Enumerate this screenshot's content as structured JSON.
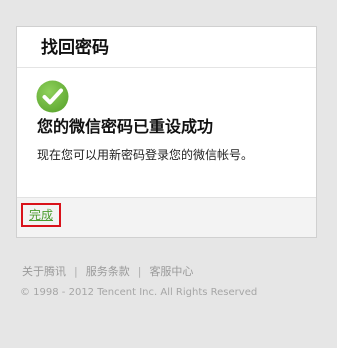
{
  "card": {
    "title": "找回密码",
    "success_title": "您的微信密码已重设成功",
    "success_desc": "现在您可以用新密码登录您的微信帐号。",
    "done_label": "完成"
  },
  "footer": {
    "links": [
      "关于腾讯",
      "服务条款",
      "客服中心"
    ],
    "separator": "|",
    "copyright": "© 1998 - 2012 Tencent Inc. All Rights Reserved"
  },
  "colors": {
    "page_bg": "#e6e6e6",
    "card_bg": "#ffffff",
    "check_green": "#6cb33f",
    "link_green": "#4b9c2e",
    "highlight_red": "#d9121a"
  },
  "icons": {
    "success": "check-circle-icon"
  }
}
